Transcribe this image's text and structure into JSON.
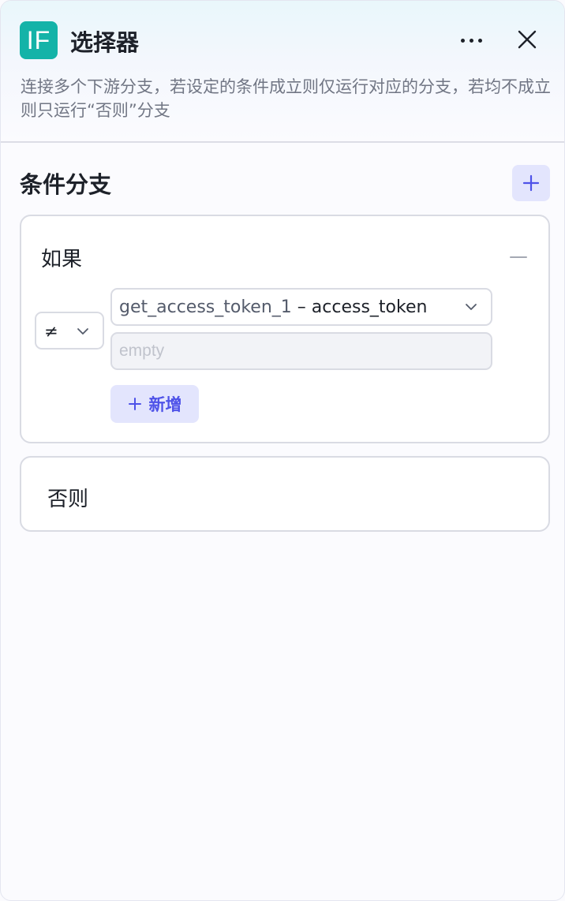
{
  "header": {
    "logo_text": "IF",
    "title": "选择器",
    "description": "连接多个下游分支，若设定的条件成立则仅运行对应的分支，若均不成立则只运行“否则”分支",
    "icons": {
      "more": "more-horizontal-icon",
      "close": "close-icon"
    }
  },
  "section": {
    "title": "条件分支",
    "add_icon": "plus-icon"
  },
  "if_card": {
    "label": "如果",
    "remove_icon": "minus-icon",
    "condition": {
      "operator": "≠",
      "variable_node": "get_access_token_1",
      "variable_separator": " – ",
      "variable_field": "access_token",
      "value": "",
      "value_placeholder": "empty"
    },
    "add_condition_label": "新增"
  },
  "else_card": {
    "label": "否则"
  },
  "colors": {
    "accent": "#4e52e8",
    "accent_bg": "#e3e5fd",
    "logo_bg": "#14b3a8",
    "border": "#d9dbe3",
    "page_bg": "#fbfbfe"
  }
}
